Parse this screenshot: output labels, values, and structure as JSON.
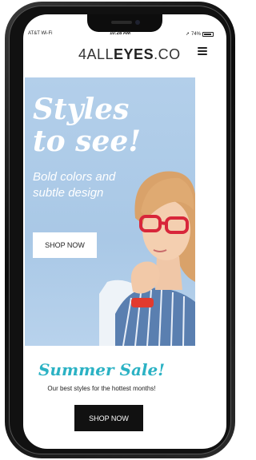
{
  "status_bar": {
    "carrier": "AT&T Wi-Fi",
    "time": "10:28 AM",
    "battery": "74%"
  },
  "header": {
    "logo_light": "4ALL",
    "logo_bold": "EYES",
    "logo_suffix": ".CO",
    "menu_icon": "hamburger-menu-icon"
  },
  "hero": {
    "headline_line1": "Styles",
    "headline_line2": "to see!",
    "subtext": "Bold colors and subtle design",
    "button_label": "SHOP NOW"
  },
  "promo": {
    "title": "Summer Sale!",
    "subtitle": "Our best styles for the hottest months!",
    "button_label": "SHOP NOW"
  },
  "colors": {
    "hero_background": "#afcbe8",
    "sale_title": "#2bb2c4",
    "glasses_frame": "#d8263a"
  }
}
